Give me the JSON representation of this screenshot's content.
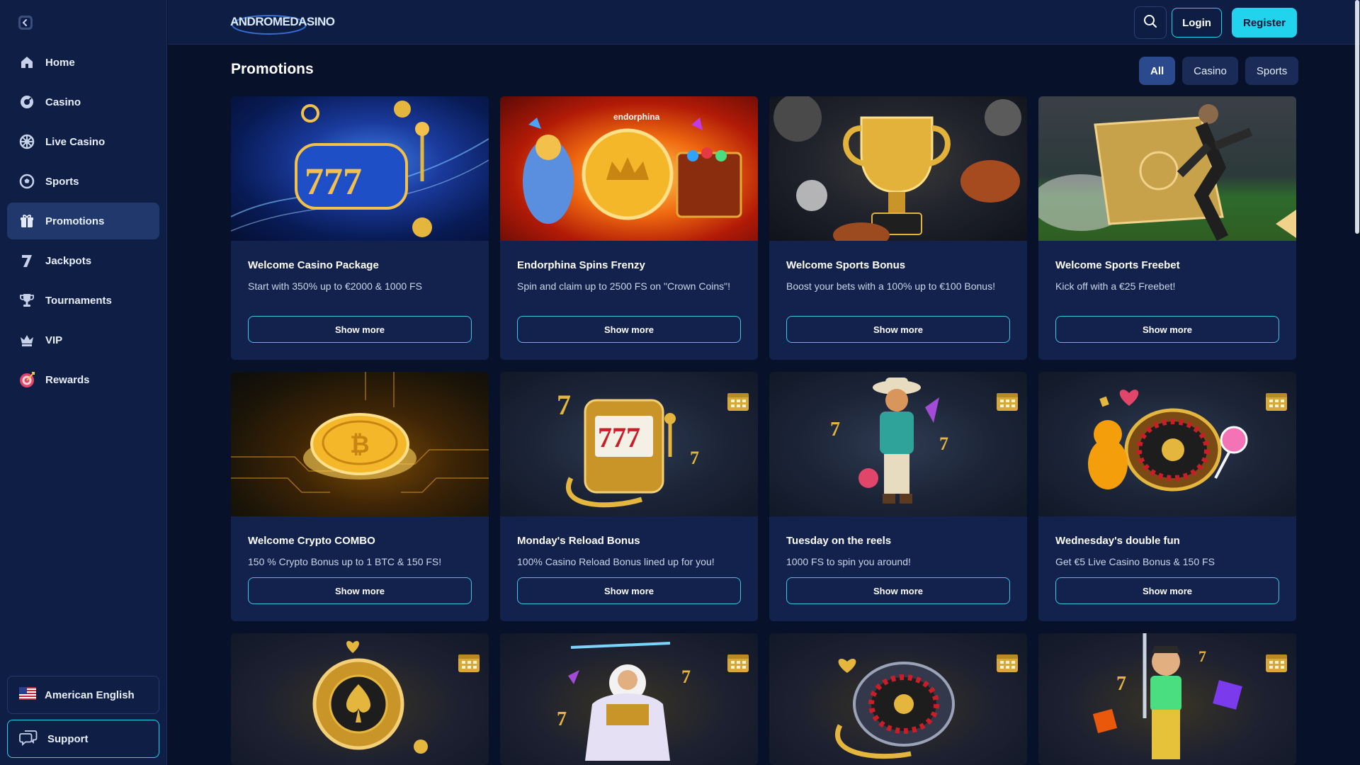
{
  "app": {
    "logo": "ANDROMEDASINO"
  },
  "sidebar": {
    "items": [
      {
        "label": "Home",
        "icon": "home-icon"
      },
      {
        "label": "Casino",
        "icon": "casino-chip-icon"
      },
      {
        "label": "Live Casino",
        "icon": "roulette-icon"
      },
      {
        "label": "Sports",
        "icon": "soccer-ball-icon"
      },
      {
        "label": "Promotions",
        "icon": "gift-icon",
        "active": true
      },
      {
        "label": "Jackpots",
        "icon": "seven-icon"
      },
      {
        "label": "Tournaments",
        "icon": "trophy-icon"
      },
      {
        "label": "VIP",
        "icon": "crown-icon"
      },
      {
        "label": "Rewards",
        "icon": "target-icon"
      }
    ],
    "language": "American English",
    "support": "Support"
  },
  "header": {
    "login": "Login",
    "register": "Register"
  },
  "main": {
    "title": "Promotions",
    "filters": [
      "All",
      "Casino",
      "Sports"
    ],
    "active_filter": "All",
    "cards": [
      {
        "title": "Welcome Casino Package",
        "desc": "Start with 350% up to €2000 & 1000 FS",
        "button": "Show more"
      },
      {
        "title": "Endorphina Spins Frenzy",
        "desc": "Spin and claim up to 2500 FS on \"Crown Coins\"!",
        "button": "Show more",
        "badge": "endorphina"
      },
      {
        "title": "Welcome Sports Bonus",
        "desc": "Boost your bets with a 100% up to €100 Bonus!",
        "button": "Show more"
      },
      {
        "title": "Welcome Sports Freebet",
        "desc": "Kick off with a €25 Freebet!",
        "button": "Show more"
      },
      {
        "title": "Welcome Crypto COMBO",
        "desc": "150 % Crypto Bonus up to 1 BTC & 150 FS!",
        "button": "Show more"
      },
      {
        "title": "Monday's Reload Bonus",
        "desc": "100% Casino Reload Bonus lined up for you!",
        "button": "Show more"
      },
      {
        "title": "Tuesday on the reels",
        "desc": "1000 FS to spin you around!",
        "button": "Show more"
      },
      {
        "title": "Wednesday's double fun",
        "desc": "Get €5 Live Casino Bonus & 150 FS",
        "button": "Show more"
      }
    ]
  },
  "colors": {
    "accent": "#22d3ee",
    "sidebar": "#0e1e45",
    "card": "#12224d",
    "active": "#20386c"
  }
}
